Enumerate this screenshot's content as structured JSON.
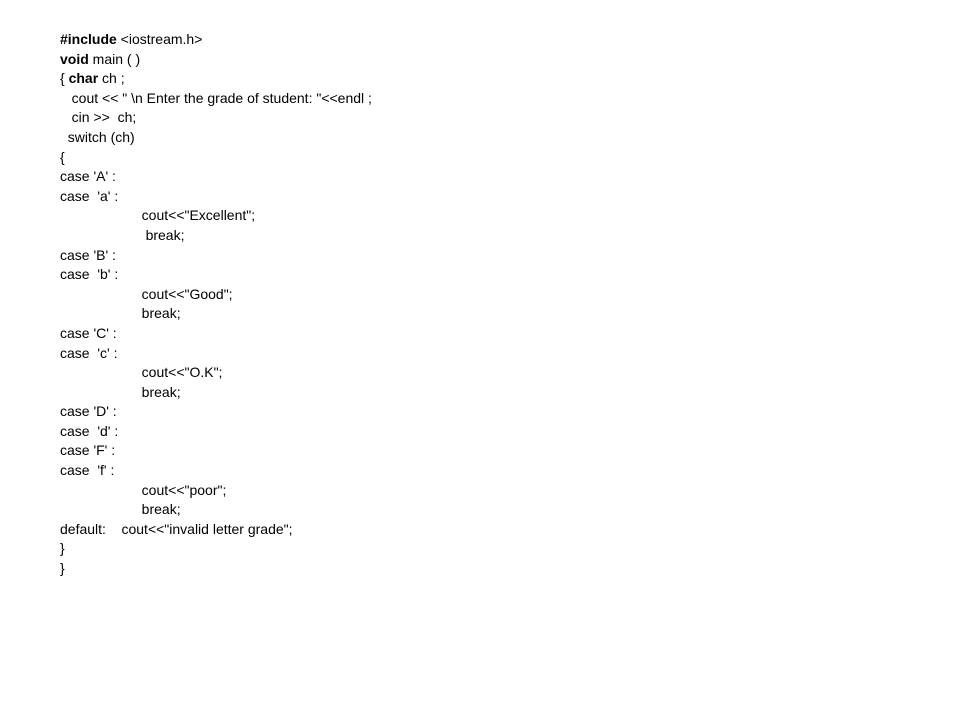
{
  "code": {
    "l1a": "#include",
    "l1b": " <iostream.h>",
    "l2a": "void",
    "l2b": " main ( )",
    "l3a": "{ ",
    "l3b": "char",
    "l3c": " ch ;",
    "l4": "   cout << \" \\n Enter the grade of student: \"<<endl ;",
    "l5": "   cin >>  ch;",
    "l6": "  switch (ch)",
    "l7": "{",
    "l8": "case 'A' :",
    "l9": "case  'a' :",
    "l10": "                     cout<<\"Excellent\";",
    "l11": "                      break;",
    "l12": "case 'B' :",
    "l13": "case  'b' :",
    "l14": "                     cout<<\"Good\";",
    "l15": "                     break;",
    "l16": "case 'C' :",
    "l17": "case  'c' :",
    "l18": "                     cout<<\"O.K\";",
    "l19": "                     break;",
    "l20": "case 'D' :",
    "l21": "case  'd' :",
    "l22": "case 'F' :",
    "l23": "case  'f' :",
    "l24": "                     cout<<\"poor\";",
    "l25": "                     break;",
    "l26": "default:    cout<<\"invalid letter grade\";",
    "l27": "}",
    "l28": "}"
  }
}
